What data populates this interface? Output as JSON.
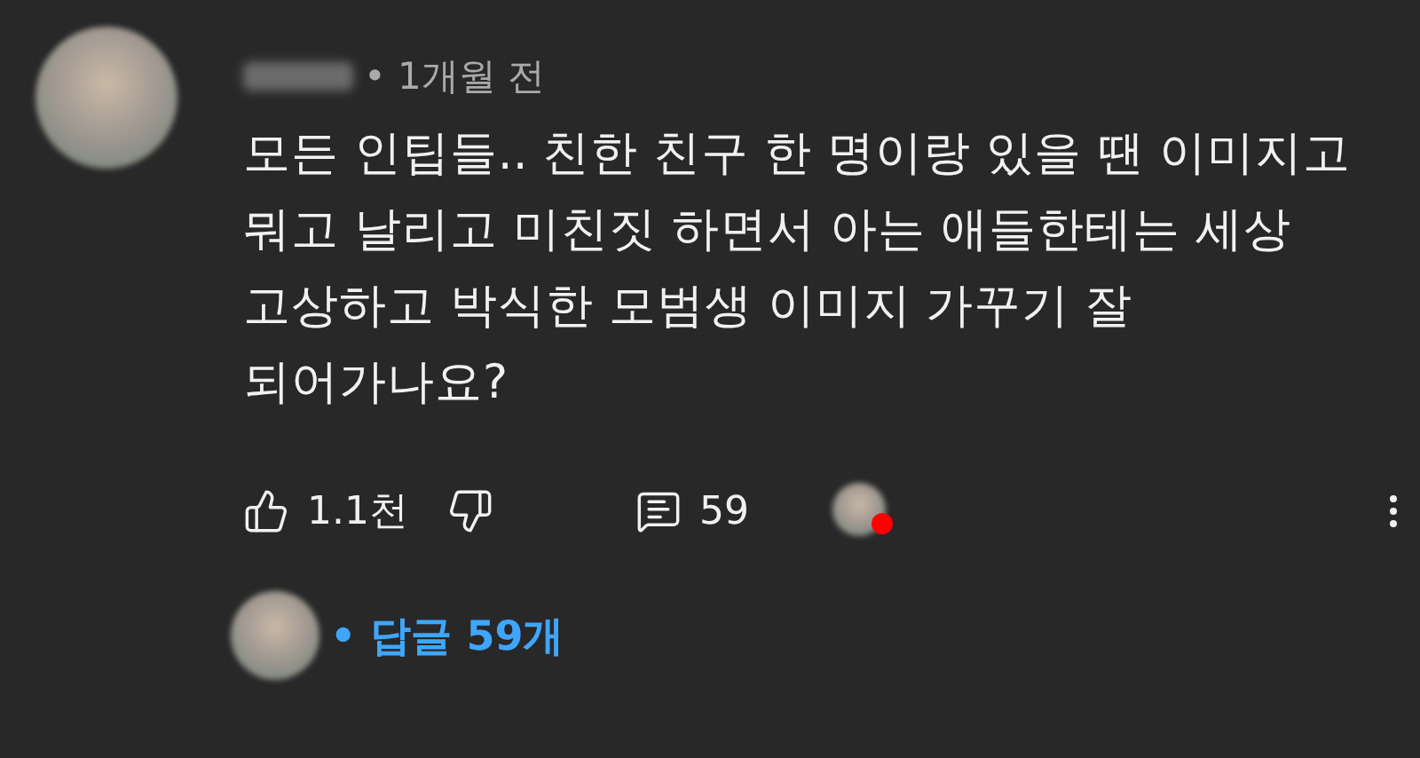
{
  "comment": {
    "time": "• 1개월 전",
    "text_lines": [
      "모든 인팁들.. 친한 친구 한 명이랑 있을 땐 이미지고",
      "뭐고 날리고 미친짓 하면서 아는 애들한테는 세상",
      "고상하고 박식한 모범생 이미지 가꾸기 잘",
      "되어가나요?"
    ],
    "likes": "1.1천",
    "reply_count": "59"
  },
  "replies": {
    "label": "• 답글 59개"
  }
}
